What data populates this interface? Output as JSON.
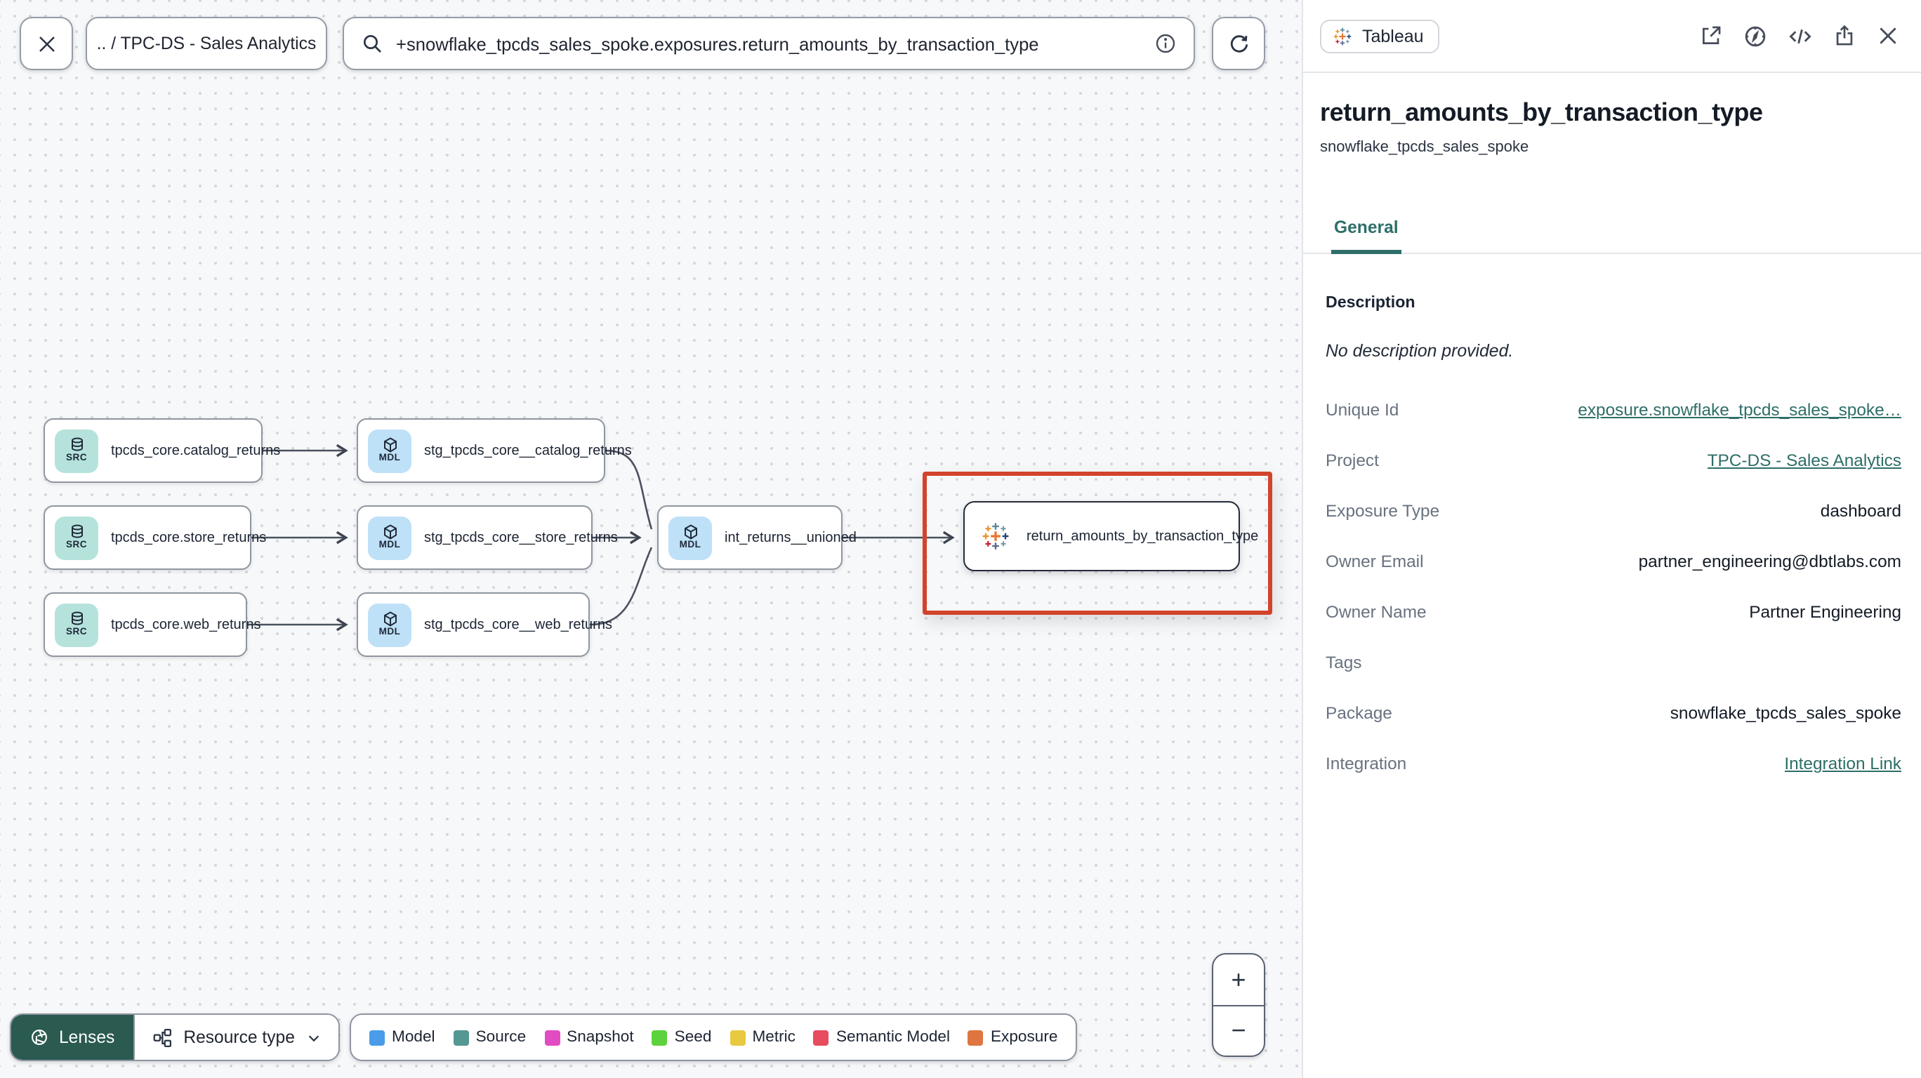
{
  "toolbar": {
    "breadcrumb": ".. / TPC-DS - Sales Analytics",
    "search_value": "+snowflake_tpcds_sales_spoke.exposures.return_amounts_by_transaction_type"
  },
  "graph": {
    "nodes": [
      {
        "badge": "SRC",
        "label": "tpcds_core.catalog_returns"
      },
      {
        "badge": "MDL",
        "label": "stg_tpcds_core__catalog_returns"
      },
      {
        "badge": "SRC",
        "label": "tpcds_core.store_returns"
      },
      {
        "badge": "MDL",
        "label": "stg_tpcds_core__store_returns"
      },
      {
        "badge": "MDL",
        "label": "int_returns__unioned"
      },
      {
        "badge": "SRC",
        "label": "tpcds_core.web_returns"
      },
      {
        "badge": "MDL",
        "label": "stg_tpcds_core__web_returns"
      },
      {
        "badge": "Tableau",
        "label": "return_amounts_by_transaction_type"
      }
    ]
  },
  "lenses": {
    "label": "Lenses",
    "resource_type_label": "Resource type"
  },
  "legend": {
    "items": [
      {
        "label": "Model",
        "color": "#4a9ce8"
      },
      {
        "label": "Source",
        "color": "#559792"
      },
      {
        "label": "Snapshot",
        "color": "#e14cc3"
      },
      {
        "label": "Seed",
        "color": "#5cd23d"
      },
      {
        "label": "Metric",
        "color": "#e9c93f"
      },
      {
        "label": "Semantic Model",
        "color": "#e74c5f"
      },
      {
        "label": "Exposure",
        "color": "#df7540"
      }
    ]
  },
  "zoom_controls": {
    "zoom_in": "+",
    "zoom_out": "−"
  },
  "panel": {
    "integration_badge": "Tableau",
    "title": "return_amounts_by_transaction_type",
    "subtitle": "snowflake_tpcds_sales_spoke",
    "tab": "General",
    "description_label": "Description",
    "description_value": "No description provided.",
    "fields": [
      {
        "label": "Unique Id",
        "value": "exposure.snowflake_tpcds_sales_spoke…",
        "link": true
      },
      {
        "label": "Project",
        "value": "TPC-DS - Sales Analytics",
        "link": true
      },
      {
        "label": "Exposure Type",
        "value": "dashboard",
        "link": false
      },
      {
        "label": "Owner Email",
        "value": "partner_engineering@dbtlabs.com",
        "link": false
      },
      {
        "label": "Owner Name",
        "value": "Partner Engineering",
        "link": false
      },
      {
        "label": "Tags",
        "value": "",
        "link": false
      },
      {
        "label": "Package",
        "value": "snowflake_tpcds_sales_spoke",
        "link": false
      },
      {
        "label": "Integration",
        "value": "Integration Link",
        "link": true
      }
    ]
  },
  "colors": {
    "accent_teal": "#2e6e68",
    "highlight_red": "#d2432b",
    "lenses_green": "#2b5a50",
    "src_badge": "#b5e3dc",
    "mdl_badge": "#bee1f8"
  }
}
